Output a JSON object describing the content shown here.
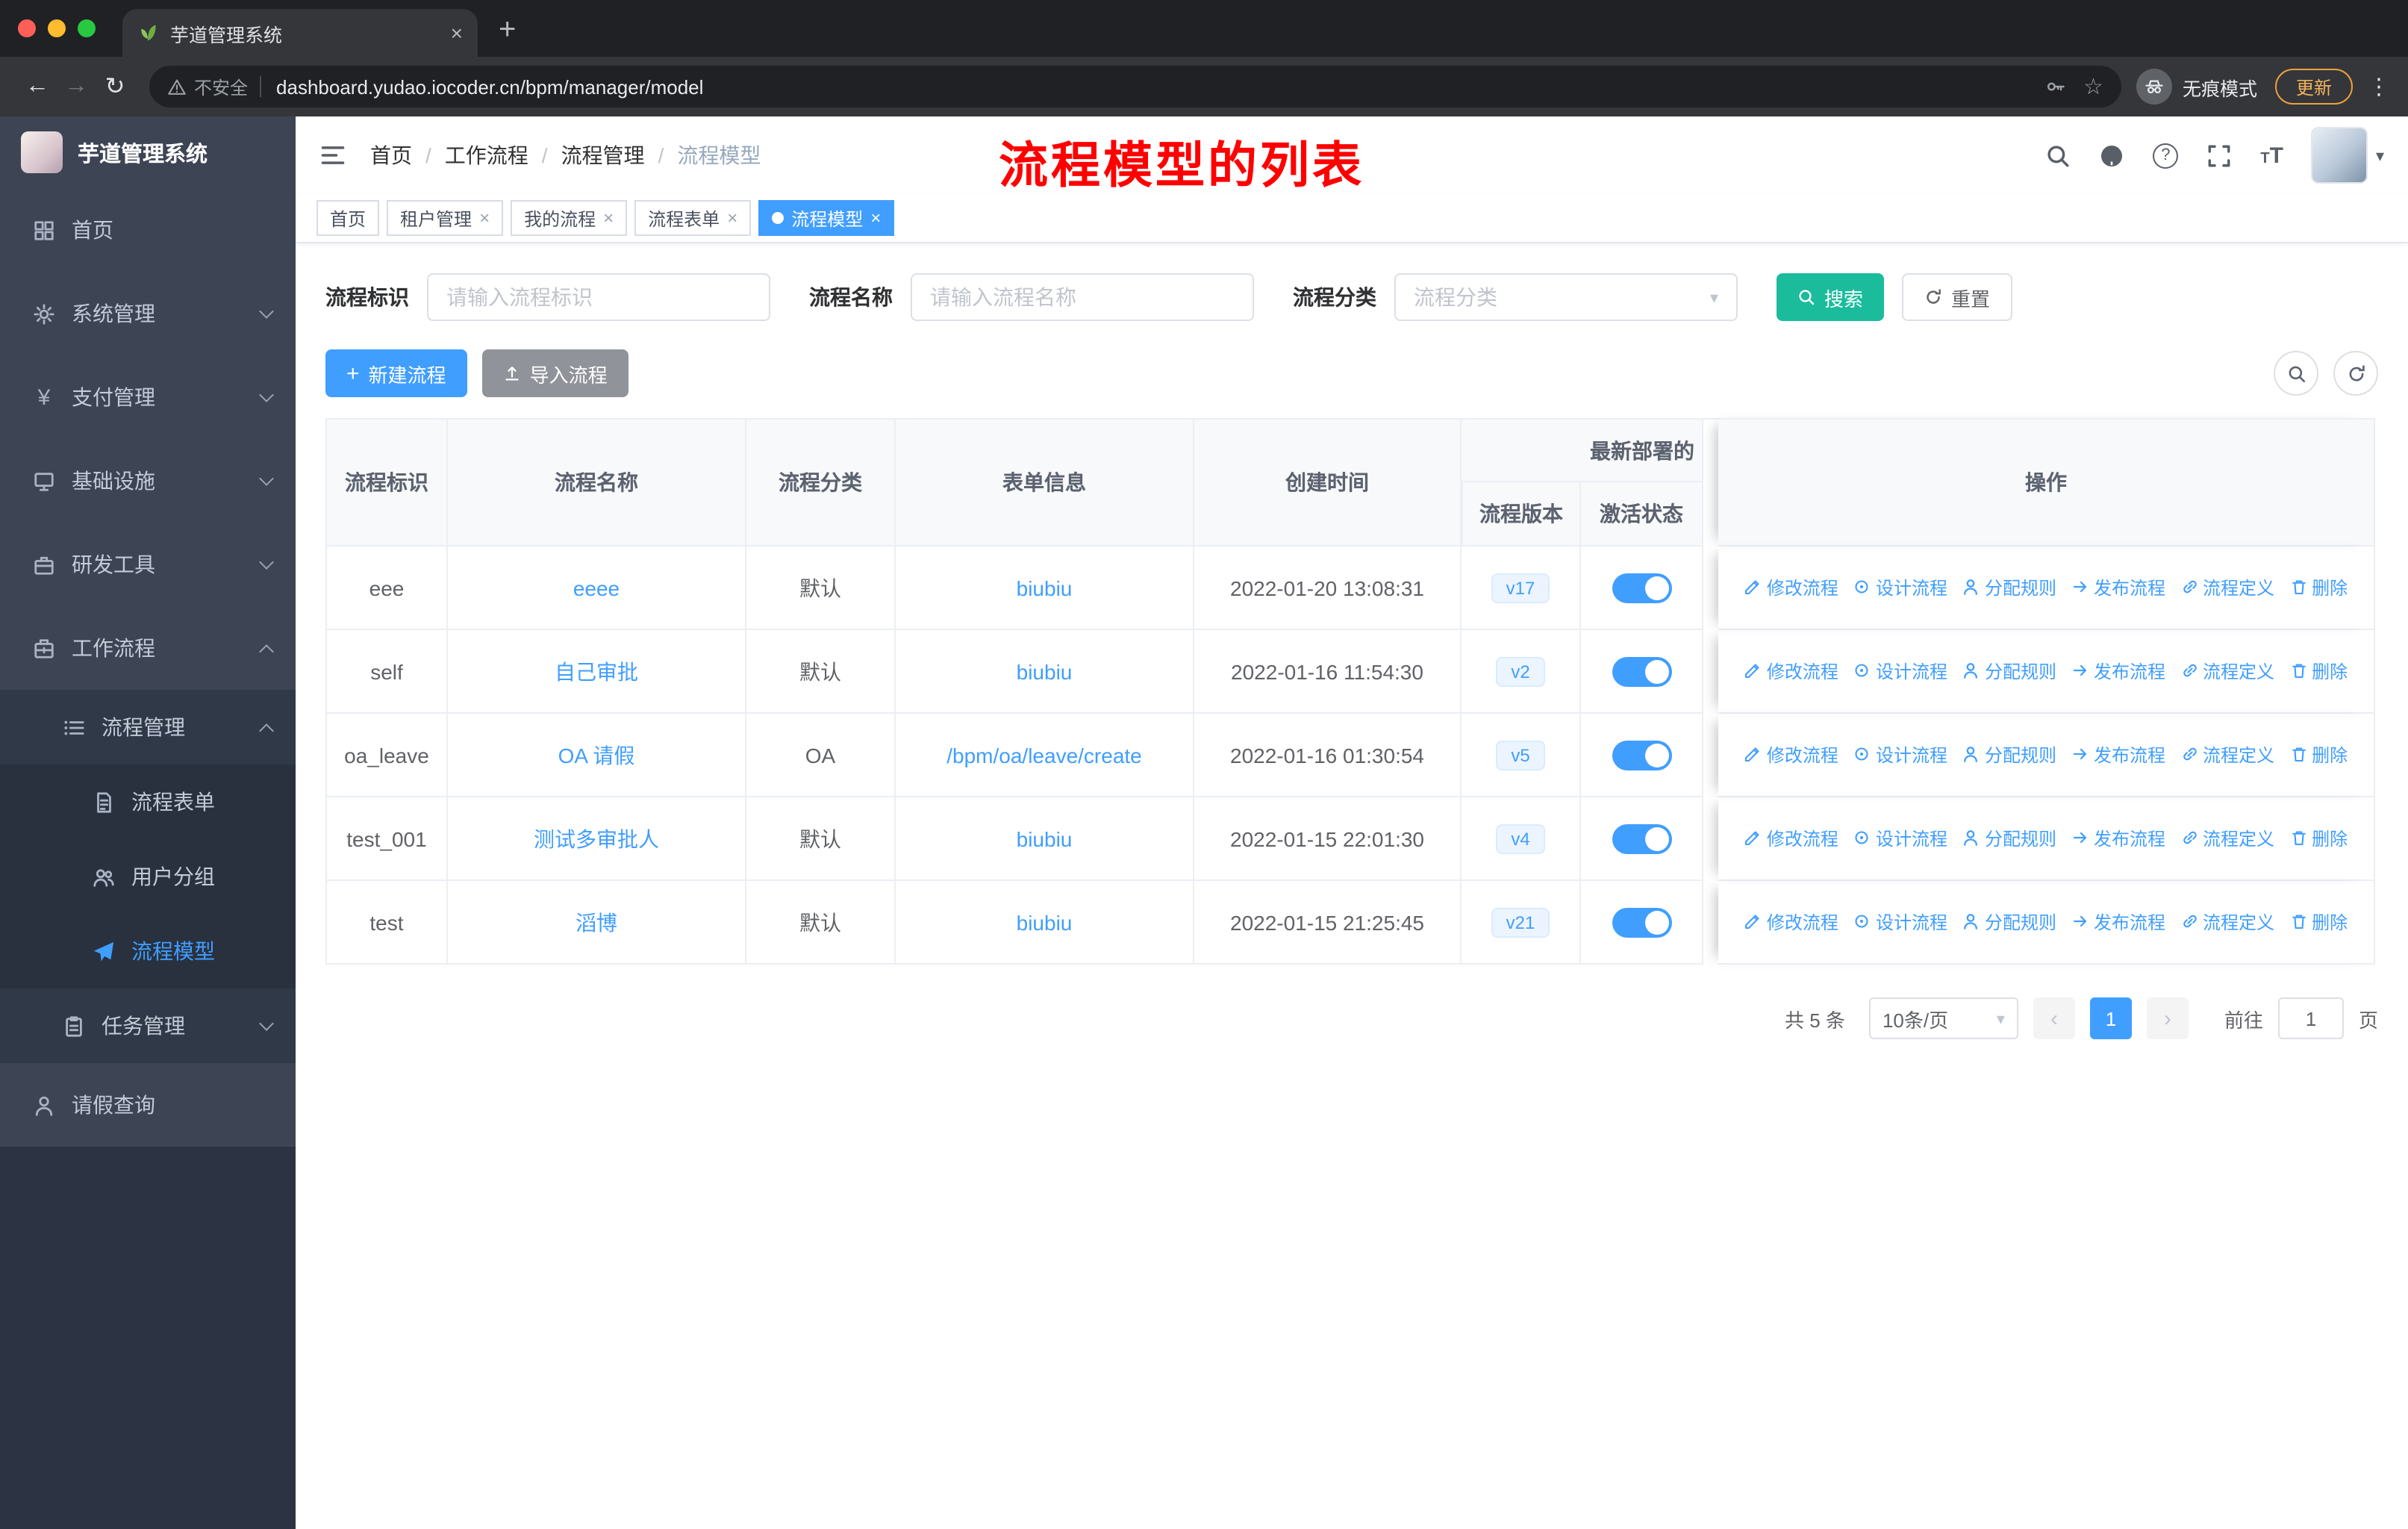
{
  "icons": {
    "plus": "+",
    "close": "×",
    "back": "←",
    "forward": "→",
    "reload": "↻",
    "kebab": "⋮",
    "star": "☆",
    "caret_down": "▾",
    "question": "?",
    "font_size": "T",
    "prev": "‹",
    "next": "›",
    "new_tab": "+",
    "yen": "¥",
    "breadcrumb_separator": "/"
  },
  "browser": {
    "tab": {
      "title": "芋道管理系统"
    },
    "address": {
      "security": "不安全",
      "url": "dashboard.yudao.iocoder.cn/bpm/manager/model"
    },
    "incognito_label": "无痕模式",
    "update_label": "更新"
  },
  "sidebar": {
    "logo_title": "芋道管理系统",
    "top_items": [
      {
        "label": "首页"
      },
      {
        "label": "系统管理"
      },
      {
        "label": "支付管理"
      },
      {
        "label": "基础设施"
      },
      {
        "label": "研发工具"
      },
      {
        "label": "工作流程"
      }
    ],
    "workflow_children": {
      "process_mgmt": {
        "label": "流程管理",
        "children": [
          {
            "label": "流程表单"
          },
          {
            "label": "用户分组"
          },
          {
            "label": "流程模型"
          }
        ]
      },
      "task_mgmt": {
        "label": "任务管理"
      }
    },
    "bottom_item": {
      "label": "请假查询"
    }
  },
  "navbar": {
    "breadcrumb": [
      "首页",
      "工作流程",
      "流程管理",
      "流程模型"
    ],
    "annotation": "流程模型的列表"
  },
  "tags": [
    {
      "label": "首页"
    },
    {
      "label": "租户管理"
    },
    {
      "label": "我的流程"
    },
    {
      "label": "流程表单"
    },
    {
      "label": "流程模型"
    }
  ],
  "search": {
    "id_label": "流程标识",
    "id_placeholder": "请输入流程标识",
    "name_label": "流程名称",
    "name_placeholder": "请输入流程名称",
    "category_label": "流程分类",
    "category_placeholder": "流程分类",
    "search_button": "搜索",
    "reset_button": "重置"
  },
  "toolbar": {
    "new_button": "新建流程",
    "import_button": "导入流程"
  },
  "table": {
    "headers": {
      "id": "流程标识",
      "name": "流程名称",
      "category": "流程分类",
      "form": "表单信息",
      "created": "创建时间",
      "deploy_group": "最新部署的",
      "version": "流程版本",
      "active": "激活状态",
      "actions": "操作"
    },
    "action_labels": [
      "修改流程",
      "设计流程",
      "分配规则",
      "发布流程",
      "流程定义",
      "删除"
    ],
    "rows": [
      {
        "id": "eee",
        "name": "eeee",
        "category": "默认",
        "form": "biubiu",
        "created": "2022-01-20 13:08:31",
        "version": "v17",
        "active": true
      },
      {
        "id": "self",
        "name": "自己审批",
        "category": "默认",
        "form": "biubiu",
        "created": "2022-01-16 11:54:30",
        "version": "v2",
        "active": true
      },
      {
        "id": "oa_leave",
        "name": "OA 请假",
        "category": "OA",
        "form": "/bpm/oa/leave/create",
        "created": "2022-01-16 01:30:54",
        "version": "v5",
        "active": true
      },
      {
        "id": "test_001",
        "name": "测试多审批人",
        "category": "默认",
        "form": "biubiu",
        "created": "2022-01-15 22:01:30",
        "version": "v4",
        "active": true
      },
      {
        "id": "test",
        "name": "滔博",
        "category": "默认",
        "form": "biubiu",
        "created": "2022-01-15 21:25:45",
        "version": "v21",
        "active": true
      }
    ]
  },
  "pagination": {
    "total": "共 5 条",
    "page_size": "10条/页",
    "current": "1",
    "goto_label": "前往",
    "goto_value": "1",
    "page_suffix": "页"
  },
  "colors": {
    "accent": "#409EFF",
    "search_button": "#1ABC9C",
    "annotation": "#FF0000",
    "toggle_on": "#409EFF"
  }
}
